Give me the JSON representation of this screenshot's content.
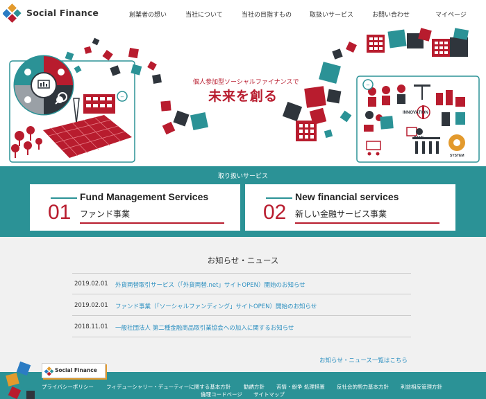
{
  "brand": {
    "name": "Social Finance",
    "colors": {
      "red": "#b81c2e",
      "teal": "#2b9296",
      "orange": "#e39a2d",
      "blue": "#2b7cc4",
      "link": "#2b8fc0",
      "dark": "#2f353c"
    }
  },
  "nav": [
    "創業者の想い",
    "当社について",
    "当社の目指すもの",
    "取扱いサービス",
    "お問い合わせ",
    "マイページ"
  ],
  "hero": {
    "tagline": "個人参加型ソーシャルファイナンスで",
    "headline": "未来を創る",
    "icon_labels": [
      "INNOVATION",
      "BANK",
      "SYSTEM"
    ]
  },
  "services": {
    "title": "取り扱いサービス",
    "items": [
      {
        "number": "01",
        "title_en": "Fund Management Services",
        "title_jp": "ファンド事業"
      },
      {
        "number": "02",
        "title_en": "New financial services",
        "title_jp": "新しい金融サービス事業"
      }
    ]
  },
  "news": {
    "title": "お知らせ・ニュース",
    "items": [
      {
        "date": "2019.02.01",
        "text": "外貨両替取引サービス（「外貨両替.net」サイトOPEN）開始のお知らせ"
      },
      {
        "date": "2019.02.01",
        "text": "ファンド事業（「ソーシャルファンディング」サイトOPEN）開始のお知らせ"
      },
      {
        "date": "2018.11.01",
        "text": "一般社団法人 第二種金融商品取引業協会への加入に関するお知らせ"
      }
    ],
    "more": "お知らせ・ニュース一覧はこちら"
  },
  "footer": {
    "badge": "Social Finance",
    "links_row1": [
      "プライバシーポリシー",
      "フィデューシャリー・デューティーに関する基本方針",
      "勧誘方針",
      "苦情・紛争 処理措置",
      "反社会的勢力基本方針",
      "利益相反管理方針"
    ],
    "links_row2": [
      "倫理コードページ",
      "サイトマップ"
    ]
  }
}
